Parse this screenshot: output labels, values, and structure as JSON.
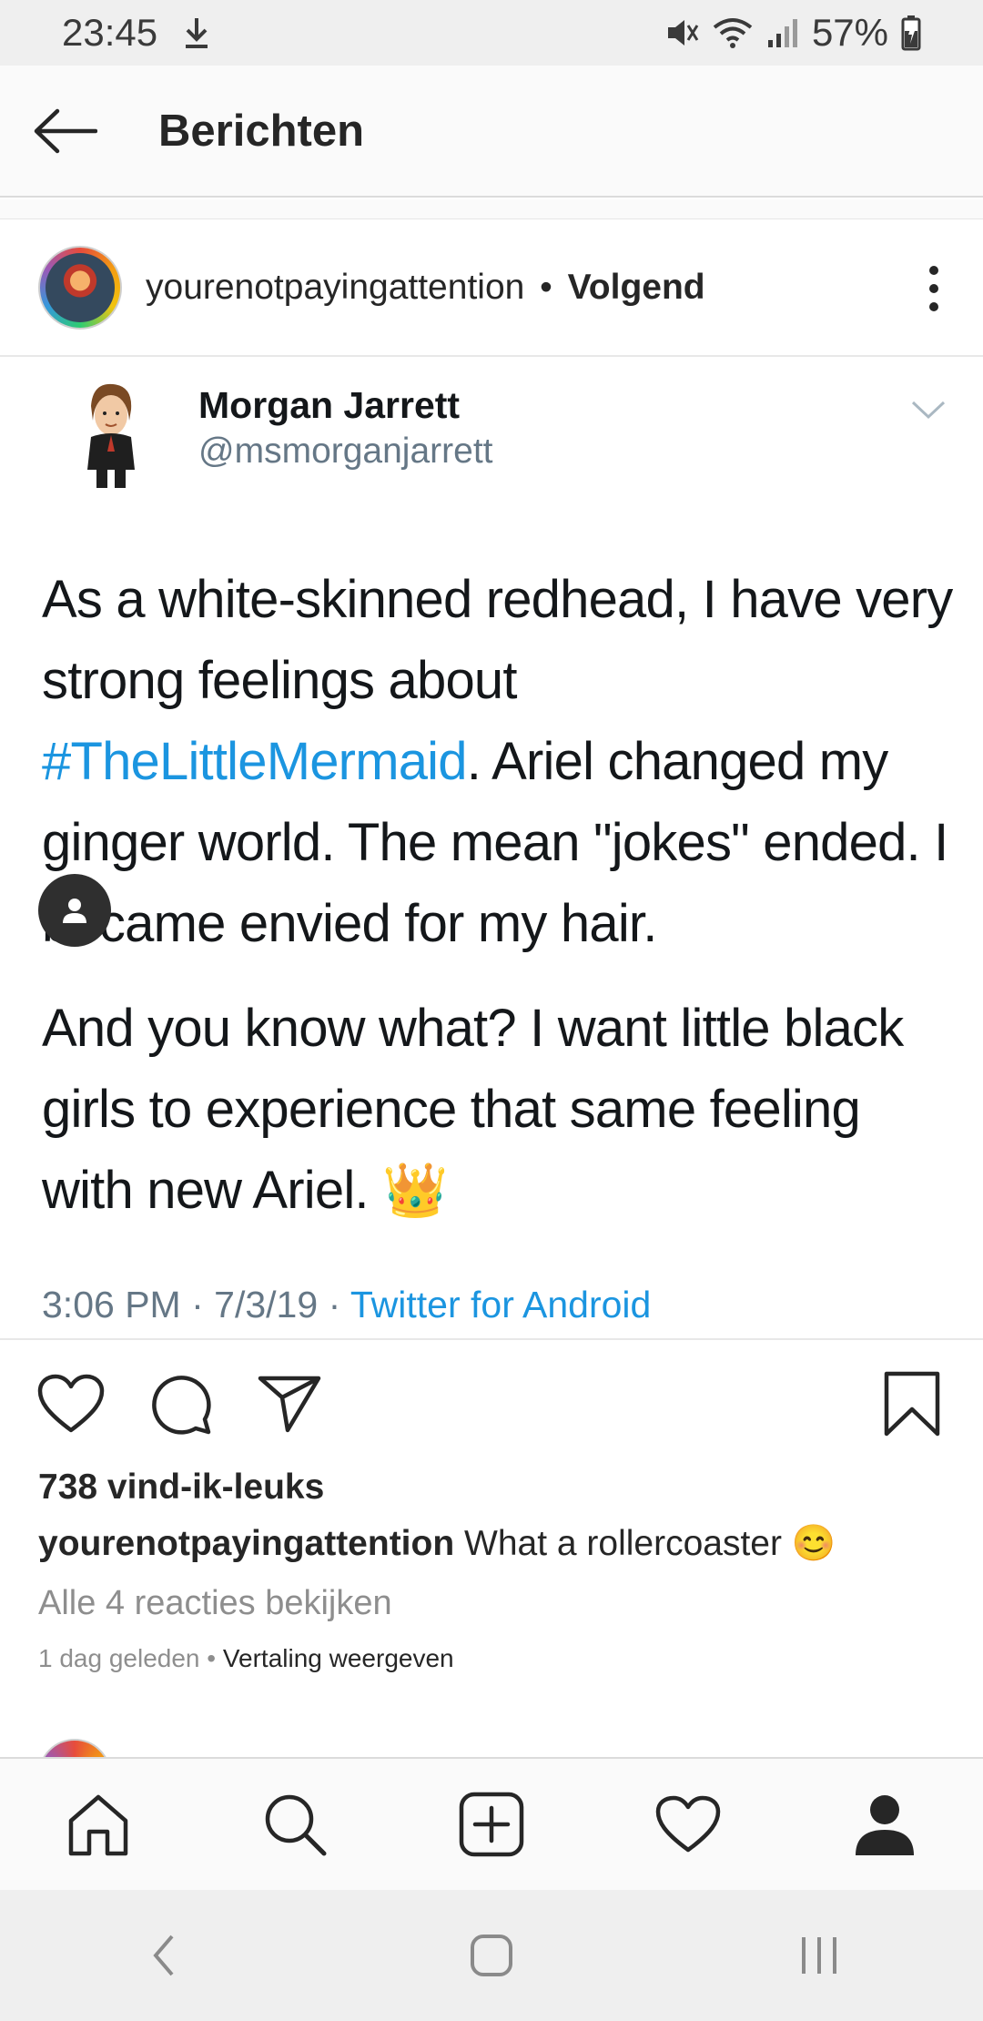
{
  "status_bar": {
    "time": "23:45",
    "battery": "57%",
    "icons": [
      "download-icon",
      "mute-icon",
      "wifi-icon",
      "signal-icon",
      "battery-icon"
    ]
  },
  "header": {
    "title": "Berichten"
  },
  "post": {
    "username": "yourenotpayingattention",
    "separator": "•",
    "follow_label": "Volgend",
    "tweet": {
      "name": "Morgan Jarrett",
      "handle": "@msmorganjarrett",
      "paragraph1_a": "As a white-skinned redhead, I have very strong feelings about ",
      "hashtag": "#TheLittleMermaid",
      "paragraph1_b": ". Ariel changed my ginger world. The mean \"jokes\" ended. I became envied for my hair.",
      "paragraph2": "And you know what? I want little black girls to experience that same feeling with new Ariel. 👑",
      "time": "3:06 PM",
      "date": "7/3/19",
      "dot": "·",
      "source": "Twitter for Android"
    },
    "likes": "738 vind-ik-leuks",
    "caption_user": "yourenotpayingattention",
    "caption_text": "What a rollercoaster 😊",
    "view_comments": "Alle 4 reacties bekijken",
    "time_ago": "1 dag geleden",
    "meta_sep": "•",
    "translate": "Vertaling weergeven"
  },
  "bottom_nav": [
    "home-icon",
    "search-icon",
    "new-post-icon",
    "activity-icon",
    "profile-icon"
  ],
  "system_nav": [
    "back",
    "home",
    "recents"
  ]
}
